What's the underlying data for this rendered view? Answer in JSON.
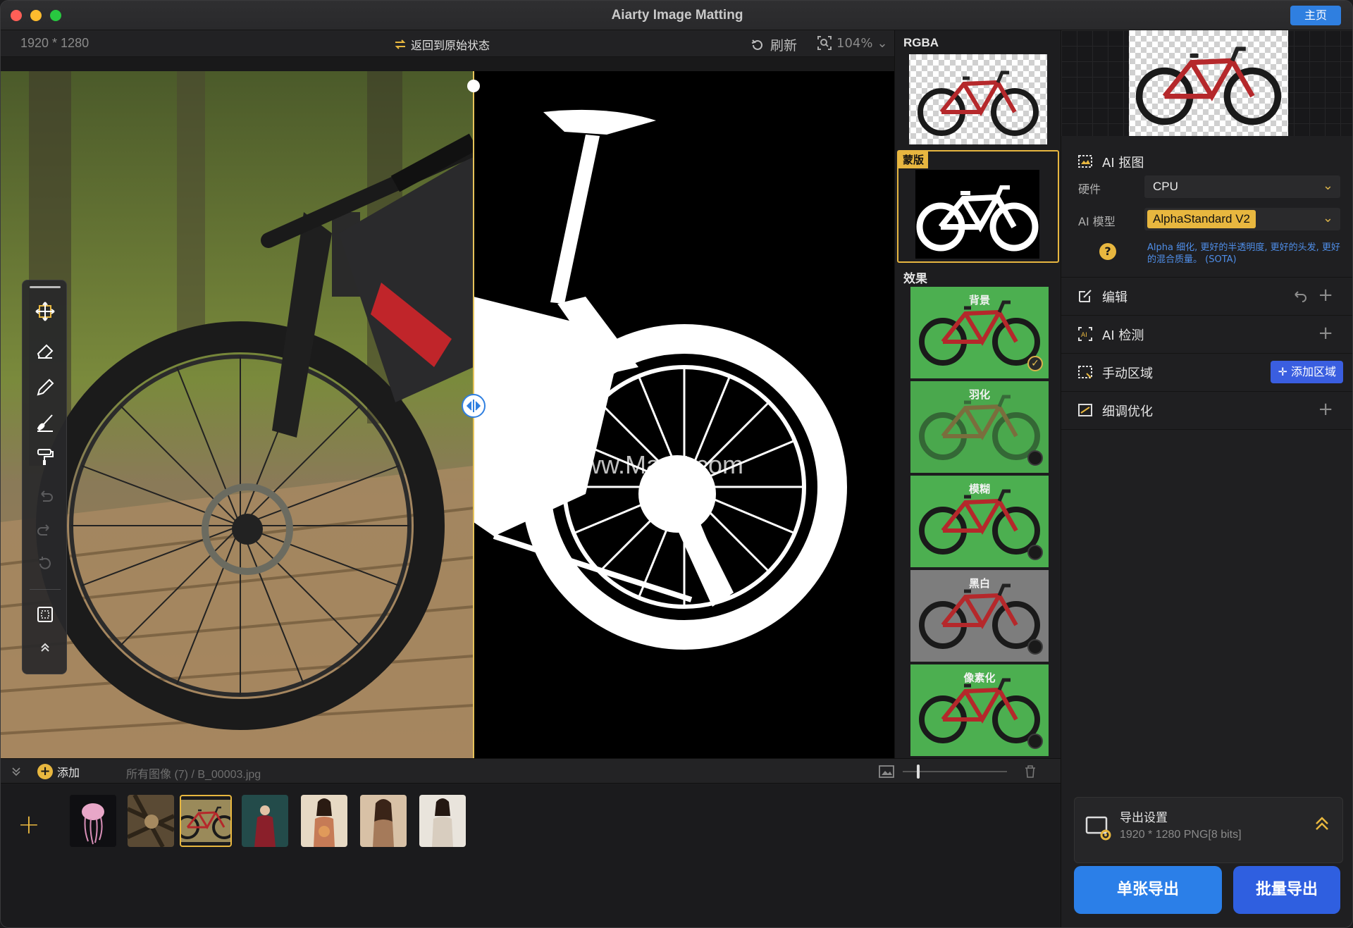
{
  "window": {
    "title": "Aiarty Image Matting",
    "home_label": "主页"
  },
  "canvas_bar": {
    "dimensions": "1920 * 1280",
    "restore_label": "返回到原始状态",
    "refresh_label": "刷新",
    "zoom": "104%"
  },
  "watermark": "www.MacZ.com",
  "tools": [
    "move-icon",
    "eraser-icon",
    "pencil-icon",
    "brush-icon",
    "fill-roller-icon",
    "undo-icon",
    "redo-icon",
    "reset-icon",
    "selection-icon",
    "collapse-up-icon"
  ],
  "preview": {
    "rgba_label": "RGBA",
    "mask_label": "蒙版",
    "effects_label": "效果",
    "effects": [
      {
        "label": "背景",
        "selected": true,
        "bg": "#4caf50"
      },
      {
        "label": "羽化",
        "selected": false,
        "bg": "#4aa84d"
      },
      {
        "label": "模糊",
        "selected": false,
        "bg": "#4caf50"
      },
      {
        "label": "黑白",
        "selected": false,
        "bg": "#7d7d7d"
      },
      {
        "label": "像素化",
        "selected": false,
        "bg": "#4caf50"
      }
    ]
  },
  "right_panel": {
    "ai_matting": {
      "title": "AI 抠图",
      "hardware_label": "硬件",
      "hardware_value": "CPU",
      "model_label": "AI 模型",
      "model_value": "AlphaStandard  V2",
      "model_desc": "Alpha 细化, 更好的半透明度, 更好的头发, 更好的混合质量。 (SOTA)"
    },
    "edit": {
      "title": "编辑"
    },
    "ai_detect": {
      "title": "AI 检测"
    },
    "manual_area": {
      "title": "手动区域",
      "add_label": "添加区域"
    },
    "refine": {
      "title": "细调优化"
    },
    "export_settings": {
      "title": "导出设置",
      "detail": "1920 * 1280 PNG[8 bits]"
    },
    "single_export": "单张导出",
    "batch_export": "批量导出"
  },
  "filmstrip": {
    "add_label": "添加",
    "path": "所有图像 (7) / B_00003.jpg",
    "thumbnails": [
      {
        "name": "jellyfish",
        "selected": false
      },
      {
        "name": "forest-creature",
        "selected": false
      },
      {
        "name": "bicycle",
        "selected": true
      },
      {
        "name": "woman-forest",
        "selected": false
      },
      {
        "name": "woman-flowers",
        "selected": false
      },
      {
        "name": "woman-portrait",
        "selected": false
      },
      {
        "name": "woman-white",
        "selected": false
      }
    ]
  },
  "colors": {
    "accent": "#e8b73f",
    "blue": "#2f7fe0",
    "effect_green": "#4caf50"
  }
}
